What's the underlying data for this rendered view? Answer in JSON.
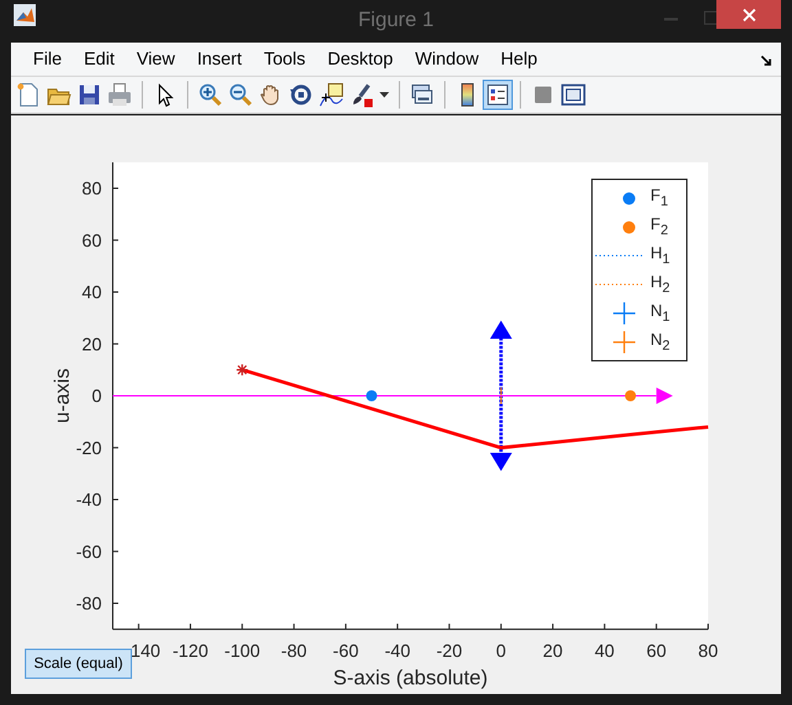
{
  "window": {
    "title": "Figure 1"
  },
  "menu": [
    {
      "label": "File"
    },
    {
      "label": "Edit"
    },
    {
      "label": "View"
    },
    {
      "label": "Insert"
    },
    {
      "label": "Tools"
    },
    {
      "label": "Desktop"
    },
    {
      "label": "Window"
    },
    {
      "label": "Help"
    }
  ],
  "toolbar": [
    {
      "kind": "new",
      "selected": false
    },
    {
      "kind": "open",
      "selected": false
    },
    {
      "kind": "save",
      "selected": false
    },
    {
      "kind": "print",
      "selected": false
    },
    {
      "kind": "separator"
    },
    {
      "kind": "pointer",
      "selected": false
    },
    {
      "kind": "separator"
    },
    {
      "kind": "zoom-in",
      "selected": false
    },
    {
      "kind": "zoom-out",
      "selected": false
    },
    {
      "kind": "pan",
      "selected": false
    },
    {
      "kind": "rotate",
      "selected": false
    },
    {
      "kind": "datacursor",
      "selected": false
    },
    {
      "kind": "brush",
      "selected": false
    },
    {
      "kind": "separator"
    },
    {
      "kind": "link",
      "selected": false
    },
    {
      "kind": "separator"
    },
    {
      "kind": "colorbar",
      "selected": false
    },
    {
      "kind": "legend",
      "selected": true
    },
    {
      "kind": "separator"
    },
    {
      "kind": "hide",
      "selected": false
    },
    {
      "kind": "show",
      "selected": false
    }
  ],
  "chart_data": {
    "type": "line",
    "xlabel": "S-axis (absolute)",
    "ylabel": "u-axis",
    "x": [
      -150,
      -100,
      -50,
      0,
      50,
      60,
      80
    ],
    "xlim": [
      -150,
      80
    ],
    "ylim": [
      -90,
      90
    ],
    "xticks": [
      {
        "value": -140,
        "label": "140"
      },
      -120,
      -100,
      -80,
      -60,
      -40,
      -20,
      0,
      20,
      40,
      60,
      80
    ],
    "yticks": [
      -80,
      -60,
      -40,
      -20,
      0,
      20,
      40,
      60,
      80
    ],
    "series": [
      {
        "color": "#ff00ff",
        "marker": "none",
        "values": [
          0,
          0,
          0,
          0,
          0,
          0,
          null
        ]
      },
      {
        "color": "#ff0000",
        "values": [
          null,
          10,
          -5,
          -20,
          -15,
          -14,
          -12
        ]
      },
      {
        "color": "#0a7cf5",
        "marker": "circle",
        "values": [
          null,
          null,
          0,
          null,
          null,
          null,
          null
        ]
      },
      {
        "color": "#ff7f0e",
        "marker": "circle",
        "values": [
          null,
          null,
          null,
          null,
          0,
          null,
          null
        ]
      }
    ]
  },
  "legend": [
    {
      "label": "F$_{1}$",
      "kind": "dot",
      "color": "#0a7cf5"
    },
    {
      "label": "F$_{2}$",
      "kind": "dot",
      "color": "#ff7f0e"
    },
    {
      "label": "H$_{1}$",
      "kind": "dotted",
      "color": "#0a7cf5"
    },
    {
      "label": "H$_{2}$",
      "kind": "dotted",
      "color": "#ff7f0e"
    },
    {
      "label": "N$_{1}$",
      "kind": "cross",
      "color": "#0a7cf5"
    },
    {
      "label": "N$_{2}$",
      "kind": "cross",
      "color": "#ff7f0e"
    }
  ],
  "button": {
    "label": "Scale (equal)"
  }
}
